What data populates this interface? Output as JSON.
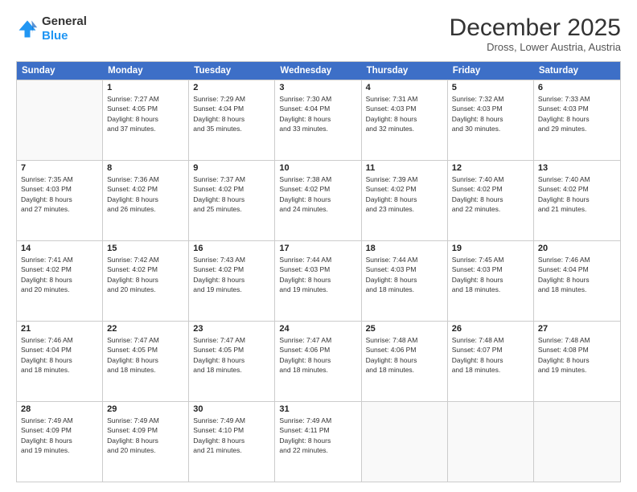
{
  "logo": {
    "general": "General",
    "blue": "Blue"
  },
  "title": "December 2025",
  "location": "Dross, Lower Austria, Austria",
  "header_days": [
    "Sunday",
    "Monday",
    "Tuesday",
    "Wednesday",
    "Thursday",
    "Friday",
    "Saturday"
  ],
  "weeks": [
    [
      {
        "day": "",
        "info": ""
      },
      {
        "day": "1",
        "info": "Sunrise: 7:27 AM\nSunset: 4:05 PM\nDaylight: 8 hours\nand 37 minutes."
      },
      {
        "day": "2",
        "info": "Sunrise: 7:29 AM\nSunset: 4:04 PM\nDaylight: 8 hours\nand 35 minutes."
      },
      {
        "day": "3",
        "info": "Sunrise: 7:30 AM\nSunset: 4:04 PM\nDaylight: 8 hours\nand 33 minutes."
      },
      {
        "day": "4",
        "info": "Sunrise: 7:31 AM\nSunset: 4:03 PM\nDaylight: 8 hours\nand 32 minutes."
      },
      {
        "day": "5",
        "info": "Sunrise: 7:32 AM\nSunset: 4:03 PM\nDaylight: 8 hours\nand 30 minutes."
      },
      {
        "day": "6",
        "info": "Sunrise: 7:33 AM\nSunset: 4:03 PM\nDaylight: 8 hours\nand 29 minutes."
      }
    ],
    [
      {
        "day": "7",
        "info": "Sunrise: 7:35 AM\nSunset: 4:03 PM\nDaylight: 8 hours\nand 27 minutes."
      },
      {
        "day": "8",
        "info": "Sunrise: 7:36 AM\nSunset: 4:02 PM\nDaylight: 8 hours\nand 26 minutes."
      },
      {
        "day": "9",
        "info": "Sunrise: 7:37 AM\nSunset: 4:02 PM\nDaylight: 8 hours\nand 25 minutes."
      },
      {
        "day": "10",
        "info": "Sunrise: 7:38 AM\nSunset: 4:02 PM\nDaylight: 8 hours\nand 24 minutes."
      },
      {
        "day": "11",
        "info": "Sunrise: 7:39 AM\nSunset: 4:02 PM\nDaylight: 8 hours\nand 23 minutes."
      },
      {
        "day": "12",
        "info": "Sunrise: 7:40 AM\nSunset: 4:02 PM\nDaylight: 8 hours\nand 22 minutes."
      },
      {
        "day": "13",
        "info": "Sunrise: 7:40 AM\nSunset: 4:02 PM\nDaylight: 8 hours\nand 21 minutes."
      }
    ],
    [
      {
        "day": "14",
        "info": "Sunrise: 7:41 AM\nSunset: 4:02 PM\nDaylight: 8 hours\nand 20 minutes."
      },
      {
        "day": "15",
        "info": "Sunrise: 7:42 AM\nSunset: 4:02 PM\nDaylight: 8 hours\nand 20 minutes."
      },
      {
        "day": "16",
        "info": "Sunrise: 7:43 AM\nSunset: 4:02 PM\nDaylight: 8 hours\nand 19 minutes."
      },
      {
        "day": "17",
        "info": "Sunrise: 7:44 AM\nSunset: 4:03 PM\nDaylight: 8 hours\nand 19 minutes."
      },
      {
        "day": "18",
        "info": "Sunrise: 7:44 AM\nSunset: 4:03 PM\nDaylight: 8 hours\nand 18 minutes."
      },
      {
        "day": "19",
        "info": "Sunrise: 7:45 AM\nSunset: 4:03 PM\nDaylight: 8 hours\nand 18 minutes."
      },
      {
        "day": "20",
        "info": "Sunrise: 7:46 AM\nSunset: 4:04 PM\nDaylight: 8 hours\nand 18 minutes."
      }
    ],
    [
      {
        "day": "21",
        "info": "Sunrise: 7:46 AM\nSunset: 4:04 PM\nDaylight: 8 hours\nand 18 minutes."
      },
      {
        "day": "22",
        "info": "Sunrise: 7:47 AM\nSunset: 4:05 PM\nDaylight: 8 hours\nand 18 minutes."
      },
      {
        "day": "23",
        "info": "Sunrise: 7:47 AM\nSunset: 4:05 PM\nDaylight: 8 hours\nand 18 minutes."
      },
      {
        "day": "24",
        "info": "Sunrise: 7:47 AM\nSunset: 4:06 PM\nDaylight: 8 hours\nand 18 minutes."
      },
      {
        "day": "25",
        "info": "Sunrise: 7:48 AM\nSunset: 4:06 PM\nDaylight: 8 hours\nand 18 minutes."
      },
      {
        "day": "26",
        "info": "Sunrise: 7:48 AM\nSunset: 4:07 PM\nDaylight: 8 hours\nand 18 minutes."
      },
      {
        "day": "27",
        "info": "Sunrise: 7:48 AM\nSunset: 4:08 PM\nDaylight: 8 hours\nand 19 minutes."
      }
    ],
    [
      {
        "day": "28",
        "info": "Sunrise: 7:49 AM\nSunset: 4:09 PM\nDaylight: 8 hours\nand 19 minutes."
      },
      {
        "day": "29",
        "info": "Sunrise: 7:49 AM\nSunset: 4:09 PM\nDaylight: 8 hours\nand 20 minutes."
      },
      {
        "day": "30",
        "info": "Sunrise: 7:49 AM\nSunset: 4:10 PM\nDaylight: 8 hours\nand 21 minutes."
      },
      {
        "day": "31",
        "info": "Sunrise: 7:49 AM\nSunset: 4:11 PM\nDaylight: 8 hours\nand 22 minutes."
      },
      {
        "day": "",
        "info": ""
      },
      {
        "day": "",
        "info": ""
      },
      {
        "day": "",
        "info": ""
      }
    ]
  ]
}
